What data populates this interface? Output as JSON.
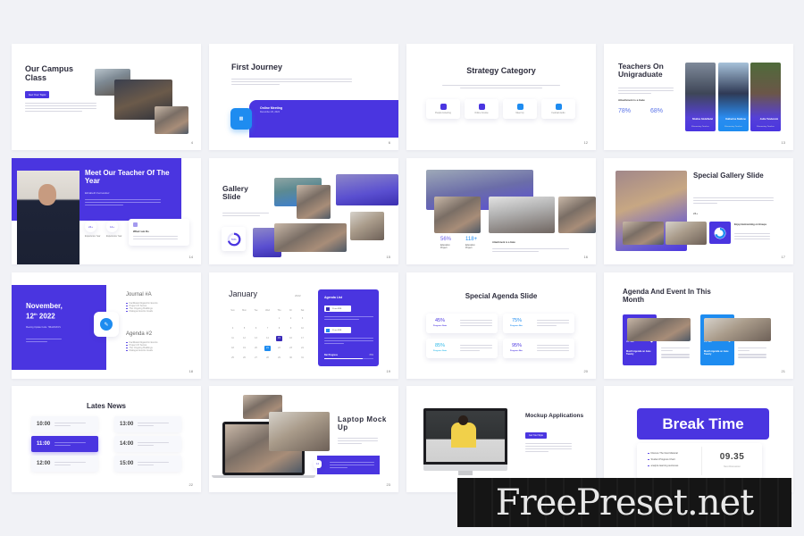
{
  "colors": {
    "accent_purple": "#4a35e0",
    "accent_blue": "#1e8cf0",
    "background": "#f1f2f6"
  },
  "slides": [
    {
      "title": "Our Campus Class",
      "button": "Get Your Topic",
      "page": "4"
    },
    {
      "title": "First Journey",
      "card_title": "Online Meeting",
      "card_date": "December 20, 2022",
      "page": "6",
      "icon": "meeting-icon"
    },
    {
      "title": "Strategy Category",
      "page": "12",
      "categories": [
        {
          "label": "People Listening",
          "icon": "people-icon"
        },
        {
          "label": "Online Course",
          "icon": "home-icon"
        },
        {
          "label": "Meet Up",
          "icon": "meetup-icon"
        },
        {
          "label": "Festival Audio",
          "icon": "audio-icon"
        }
      ]
    },
    {
      "title": "Teachers On Unigraduate",
      "subtitle": "Attachment is a Gate",
      "page": "13",
      "stats": [
        {
          "value": "78%"
        },
        {
          "value": "68%"
        }
      ],
      "teachers": [
        {
          "name": "Shaline Abdelfadel",
          "role": "Elementary Teacher"
        },
        {
          "name": "Katherine Stallone",
          "role": "Elementary Teacher"
        },
        {
          "name": "Jodie Tanderami",
          "role": "Elementary Teacher"
        }
      ]
    },
    {
      "title": "Meet Our Teacher Of The Year",
      "name": "Elizabeth Fernandez",
      "page": "14",
      "stats": [
        {
          "value": "24+",
          "label": "Experience Year"
        },
        {
          "value": "14+",
          "label": "Experience Year"
        }
      ],
      "card_title": "What I am Do"
    },
    {
      "title": "Gallery Slide",
      "donut_label": "70%",
      "page": "15"
    },
    {
      "page": "16",
      "stats": [
        {
          "value": "56%",
          "label": "Education Project"
        },
        {
          "value": "118+",
          "label": "Education Project"
        }
      ],
      "text_title": "Attachment is a Gate"
    },
    {
      "title": "Special Gallery Slide",
      "stat": "24+",
      "donut_label": "70%",
      "card_title": "Enjoy Harmonizing on Groups",
      "page": "17"
    },
    {
      "date_line1": "November,",
      "date_day": "12",
      "date_sup": "th",
      "date_year": "2022",
      "meeting": "Meeting Update Code: 7Rko9X2KJS",
      "journal_title": "Journal #A",
      "agenda_title": "Agenda #2",
      "page": "18",
      "journal_items": [
        "Facilitated Algaoritm Events",
        "Project Of Senior",
        "The Ongoing Buildings",
        "Dialogue Events Goals"
      ],
      "agenda_items": [
        "Facilitated Algaoritm Events",
        "Project Of Senior",
        "The Ongoing Buildings",
        "Dialogue Events Goals"
      ]
    },
    {
      "month": "January",
      "year": "2022",
      "page": "19",
      "weekdays": [
        "Sun",
        "Mon",
        "Tue",
        "Wed",
        "Thu",
        "Fri",
        "Sat"
      ],
      "days": [
        "",
        "",
        "",
        "",
        "1",
        "2",
        "3",
        "4",
        "5",
        "6",
        "7",
        "8",
        "9",
        "10",
        "11",
        "12",
        "13",
        "14",
        "15",
        "16",
        "17",
        "18",
        "19",
        "20",
        "21",
        "22",
        "23",
        "24",
        "25",
        "26",
        "27",
        "28",
        "29",
        "30",
        "31"
      ],
      "highlight_purple": "15",
      "highlight_blue": "21",
      "agenda_title": "Agenda List",
      "agenda_items": [
        {
          "time": "11 am WIB"
        },
        {
          "time": "11 am WIB"
        }
      ],
      "progress_label": "Bar Progress",
      "progress_value": "78%",
      "progress": 0.78
    },
    {
      "title": "Special Agenda Slide",
      "page": "20",
      "items": [
        {
          "value": "45%",
          "label": "Progress Data",
          "color": "#4a35e0"
        },
        {
          "value": "75%",
          "label": "Progress Bar",
          "color": "#1e8cf0"
        },
        {
          "value": "85%",
          "label": "Progress Data",
          "color": "#2bb8e8"
        },
        {
          "value": "95%",
          "label": "Progress Bar",
          "color": "#4a35e0"
        }
      ]
    },
    {
      "title": "Agenda And Event In This Month",
      "page": "21",
      "events": [
        {
          "date": "28 Jan",
          "title": "Month Agenda on June Twenty",
          "color": "#4a35e0"
        },
        {
          "date": "29 Jan",
          "title": "Month Agenda on June Twenty",
          "color": "#1e8cf0"
        }
      ]
    },
    {
      "title": "Lates News",
      "page": "22",
      "times": [
        "10:00",
        "11:00",
        "12:00",
        "13:00",
        "14:00",
        "15:00"
      ],
      "active_index": 1
    },
    {
      "title": "Laptop Mock Up",
      "badge": "14",
      "page": "23"
    },
    {
      "title": "Mockup Applications",
      "button": "Get Your Style",
      "page": "24"
    },
    {
      "title": "Break Time",
      "time": "09.35",
      "time_label": "Next Discussion",
      "items": [
        "Discuss The Next Material",
        "Student Progress Chart",
        "analyze learning outcomes"
      ]
    }
  ],
  "watermark": "FreePreset.net"
}
